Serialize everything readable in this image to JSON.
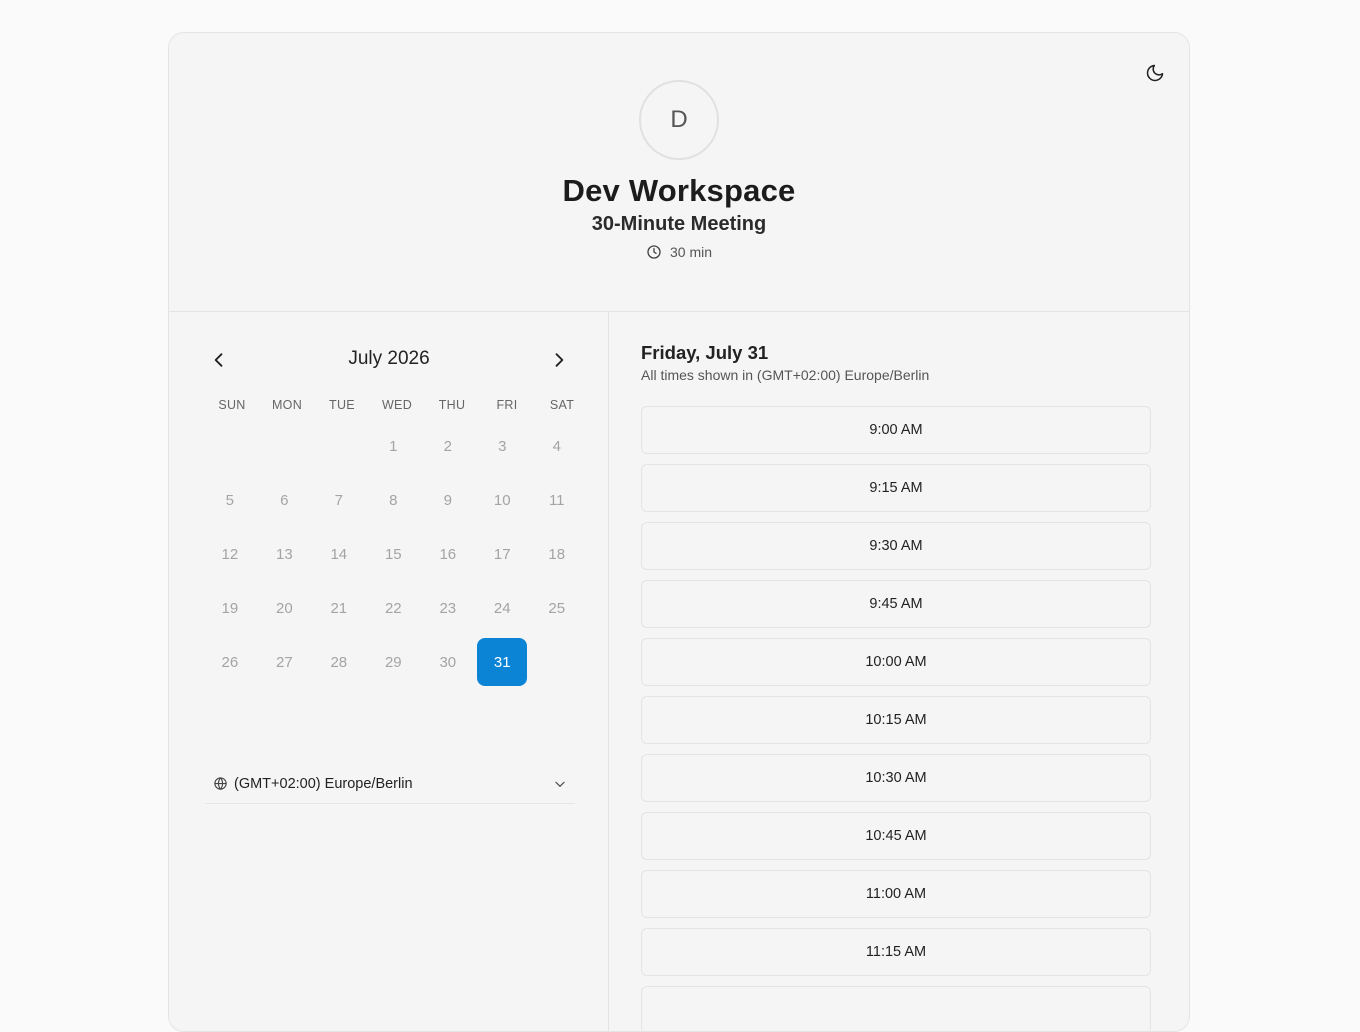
{
  "header": {
    "avatar_initial": "D",
    "workspace_name": "Dev Workspace",
    "event_name": "30-Minute Meeting",
    "duration": "30 min",
    "theme_icon": "moon-icon"
  },
  "calendar": {
    "month_title": "July 2026",
    "weekdays": [
      "SUN",
      "MON",
      "TUE",
      "WED",
      "THU",
      "FRI",
      "SAT"
    ],
    "leading_blank_days": 3,
    "days": [
      "1",
      "2",
      "3",
      "4",
      "5",
      "6",
      "7",
      "8",
      "9",
      "10",
      "11",
      "12",
      "13",
      "14",
      "15",
      "16",
      "17",
      "18",
      "19",
      "20",
      "21",
      "22",
      "23",
      "24",
      "25",
      "26",
      "27",
      "28",
      "29",
      "30",
      "31"
    ],
    "selected_day": "31",
    "timezone": "(GMT+02:00) Europe/Berlin"
  },
  "slots_panel": {
    "date_heading": "Friday, July 31",
    "timezone_note": "All times shown in (GMT+02:00) Europe/Berlin",
    "slots": [
      "9:00 AM",
      "9:15 AM",
      "9:30 AM",
      "9:45 AM",
      "10:00 AM",
      "10:15 AM",
      "10:30 AM",
      "10:45 AM",
      "11:00 AM",
      "11:15 AM",
      ""
    ]
  },
  "colors": {
    "accent": "#0b84d6",
    "background": "#fafafa",
    "card": "#f5f5f5",
    "border": "#e4e4e4"
  }
}
